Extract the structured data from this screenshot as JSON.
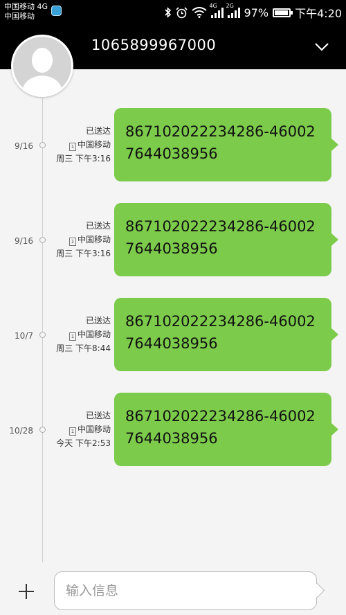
{
  "status_bar": {
    "carrier_line1": "中国移动 4G",
    "carrier_line2": "中国移动",
    "signal1_label": "4G",
    "signal2_label": "2G",
    "battery_percent": "97%",
    "battery_level": 0.97,
    "time": "下午4:20",
    "icons": [
      "app-icon",
      "bluetooth-icon",
      "alarm-icon",
      "wifi-icon",
      "signal-icon",
      "battery-icon"
    ]
  },
  "header": {
    "contact_number": "1065899967000",
    "expand_icon": "chevron-down-icon"
  },
  "messages": [
    {
      "date": "9/16",
      "status": "已送达",
      "sim": "中国移动",
      "sim_index": "1",
      "time": "周三 下午3:16",
      "text": "867102022234286-460027644038956"
    },
    {
      "date": "9/16",
      "status": "已送达",
      "sim": "中国移动",
      "sim_index": "1",
      "time": "周三 下午3:16",
      "text": "867102022234286-460027644038956"
    },
    {
      "date": "10/7",
      "status": "已送达",
      "sim": "中国移动",
      "sim_index": "1",
      "time": "周三 下午8:44",
      "text": "867102022234286-460027644038956"
    },
    {
      "date": "10/28",
      "status": "已送达",
      "sim": "中国移动",
      "sim_index": "1",
      "time": "今天 下午2:53",
      "text": "867102022234286-460027644038956"
    }
  ],
  "composer": {
    "placeholder": "输入信息",
    "add_icon": "plus-icon"
  },
  "colors": {
    "bubble": "#7ccb4b",
    "header": "#000000",
    "background": "#f4f4f4"
  }
}
